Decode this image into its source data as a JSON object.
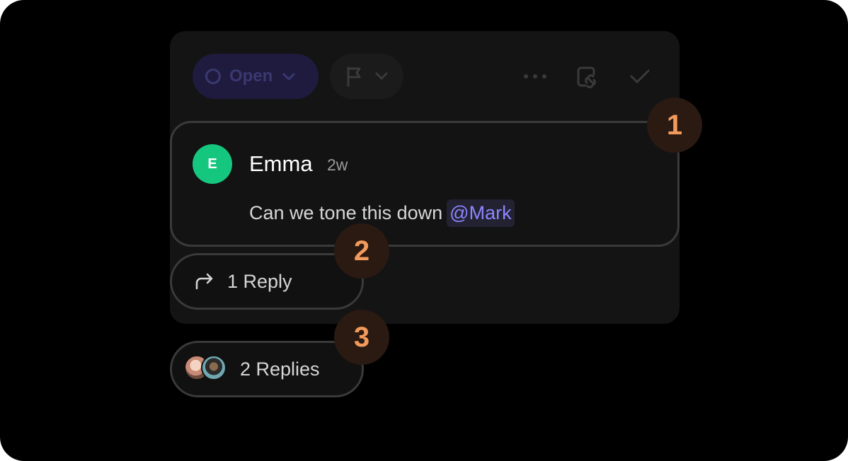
{
  "toolbar": {
    "status_label": "Open",
    "icons": [
      "status-circle-icon",
      "chevron-down-icon",
      "flag-icon",
      "more-icon",
      "copy-link-icon",
      "check-icon"
    ]
  },
  "comment": {
    "author_initial": "E",
    "author": "Emma",
    "time": "2w",
    "text": "Can we tone this down",
    "mention": "@Mark"
  },
  "replies": {
    "single_label": "1 Reply",
    "multi_label": "2 Replies"
  },
  "callouts": [
    "1",
    "2",
    "3"
  ],
  "colors": {
    "avatar": "#15c77e",
    "mention": "#8c86ff",
    "callout": "#f29a5c"
  }
}
